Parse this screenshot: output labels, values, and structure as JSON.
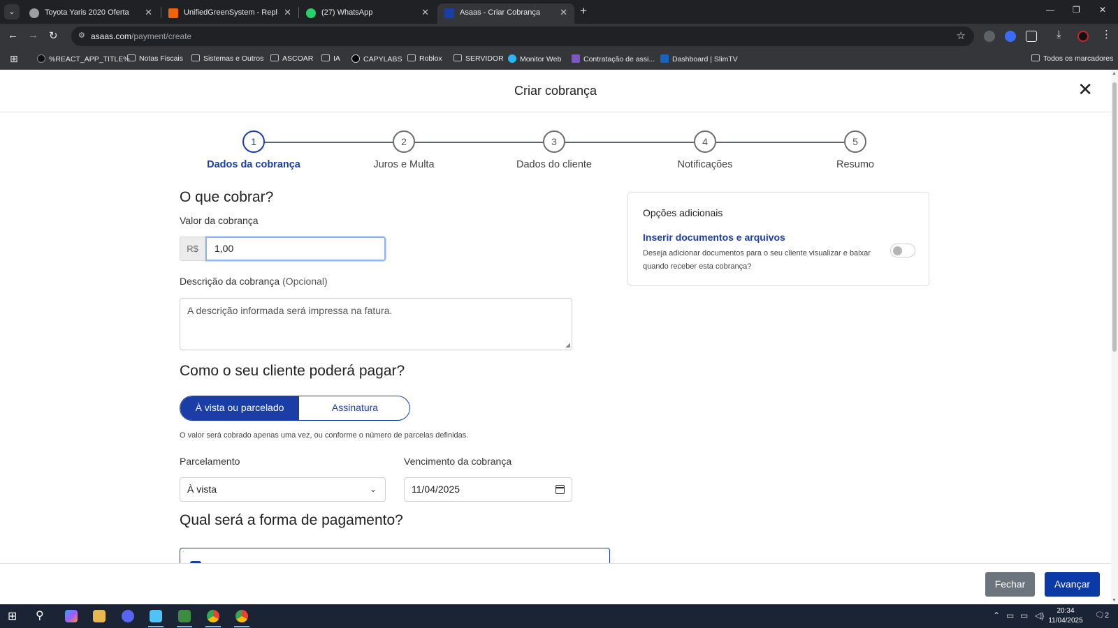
{
  "browser": {
    "tabs": [
      {
        "title": "Toyota Yaris 2020 Oferta",
        "favicon_color": "#9e9e9e"
      },
      {
        "title": "UnifiedGreenSystem - Replit",
        "favicon_color": "#f26207"
      },
      {
        "title": "(27) WhatsApp",
        "favicon_color": "#25d366"
      },
      {
        "title": "Asaas - Criar Cobrança",
        "favicon_color": "#1a3ea6"
      }
    ],
    "url_host": "asaas.com",
    "url_path": "/payment/create",
    "bookmarks": [
      "%REACT_APP_TITLE%",
      "Notas Fiscais",
      "Sistemas e Outros",
      "ASCOAR",
      "IA",
      "CAPYLABS",
      "Roblox",
      "SERVIDOR",
      "Monitor Web",
      "Contratação de assi...",
      "Dashboard | SlimTV"
    ],
    "all_bookmarks": "Todos os marcadores"
  },
  "modal": {
    "title": "Criar cobrança",
    "steps": [
      {
        "number": "1",
        "label": "Dados da cobrança"
      },
      {
        "number": "2",
        "label": "Juros e Multa"
      },
      {
        "number": "3",
        "label": "Dados do cliente"
      },
      {
        "number": "4",
        "label": "Notificações"
      },
      {
        "number": "5",
        "label": "Resumo"
      }
    ],
    "what_heading": "O que cobrar?",
    "amount_label": "Valor da cobrança",
    "currency_prefix": "R$",
    "amount_value": "1,00",
    "description_label": "Descrição da cobrança",
    "description_optional": "(Opcional)",
    "description_placeholder": "A descrição informada será impressa na fatura.",
    "how_heading": "Como o seu cliente poderá pagar?",
    "option_single": "À vista ou parcelado",
    "option_subscription": "Assinatura",
    "option_helper": "O valor será cobrado apenas uma vez, ou conforme o número de parcelas definidas.",
    "installments_label": "Parcelamento",
    "installments_value": "À vista",
    "due_label": "Vencimento da cobrança",
    "due_value": "11/04/2025",
    "payment_heading": "Qual será a forma de pagamento?",
    "side": {
      "title": "Opções adicionais",
      "link": "Inserir documentos e arquivos",
      "description": "Deseja adicionar documentos para o seu cliente visualizar e baixar quando receber esta cobrança?"
    },
    "btn_close": "Fechar",
    "btn_next": "Avançar"
  },
  "taskbar": {
    "time": "20:34",
    "date": "11/04/2025",
    "notifications": "2"
  }
}
